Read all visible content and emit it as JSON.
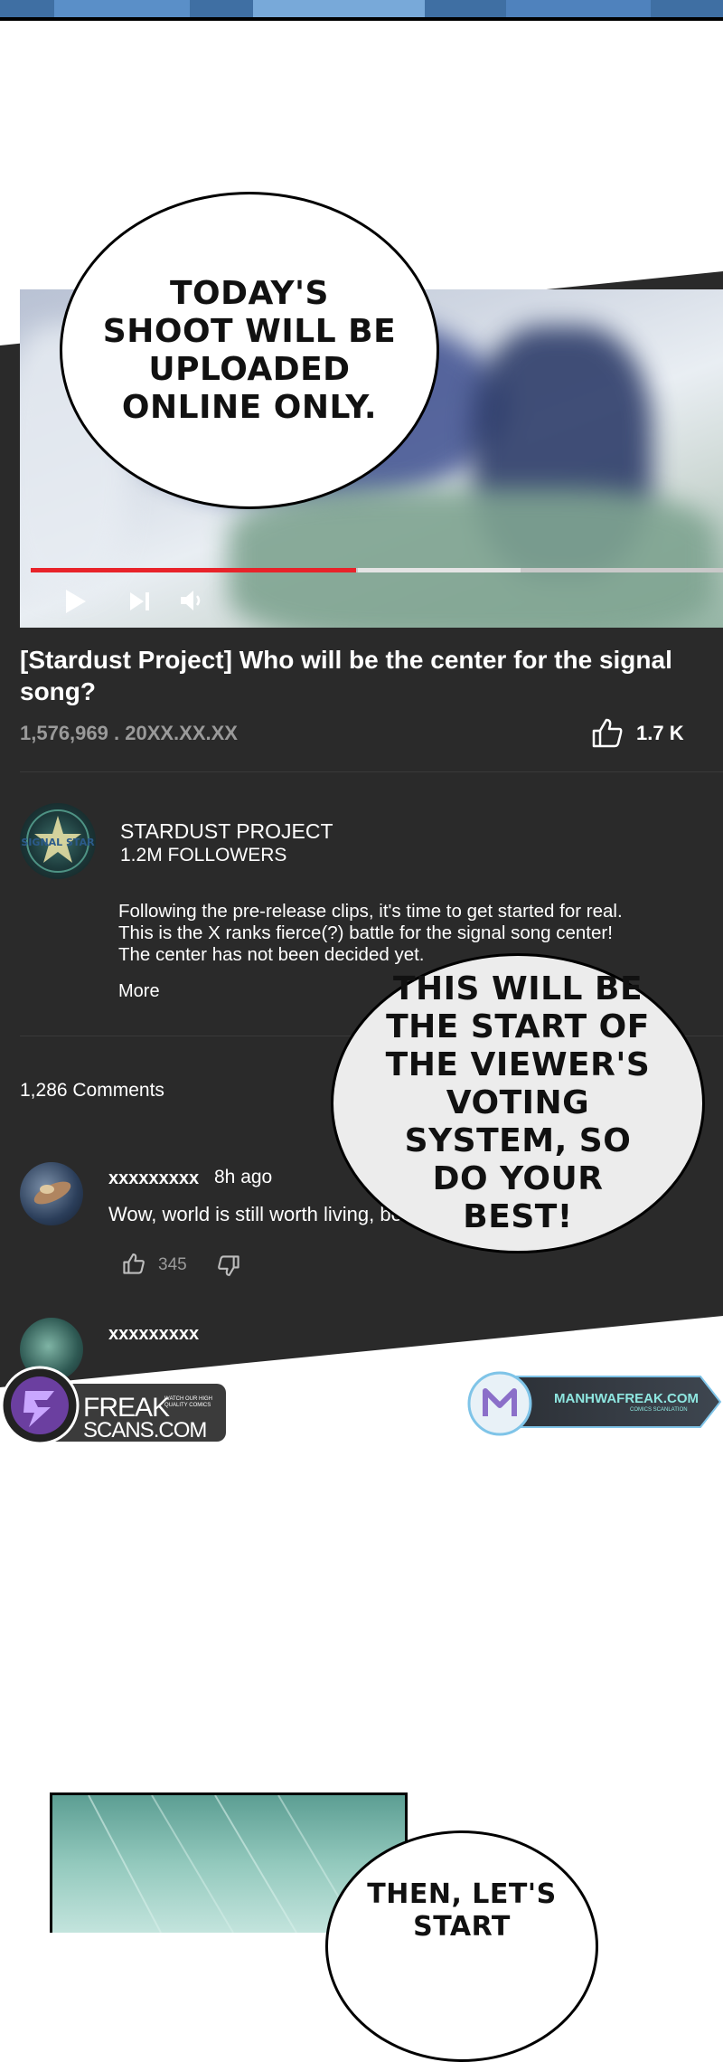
{
  "top_panel": {
    "kind": "comic-panel-edge"
  },
  "bubbles": {
    "shoot_text": "TODAY'S SHOOT WILL BE UPLOADED ONLINE ONLY.",
    "voting_text": "THIS WILL BE THE START OF THE VIEWER'S VOTING SYSTEM, SO DO YOUR BEST!",
    "start_text": "THEN, LET'S START"
  },
  "video": {
    "title": "[Stardust Project] Who will be the center for the signal song?",
    "views": "1,576,969",
    "date": ". 20XX.XX.XX",
    "likes": "1.7 K",
    "progress_fraction": 0.47,
    "controls": [
      "play-icon",
      "skip-next-icon",
      "volume-icon",
      "thumbs-up-icon"
    ]
  },
  "channel": {
    "name": "STARDUST PROJECT",
    "followers": "1.2M FOLLOWERS",
    "logo_text": "SIGNAL STAR",
    "description_lines": [
      "Following the pre-release clips, it's time to get started for real.",
      "This is the X ranks fierce(?) battle for the signal song center!",
      "The center has not been decided yet."
    ],
    "more_label": "More"
  },
  "comments": {
    "count_label": "1,286 Comments",
    "items": [
      {
        "user": "xxxxxxxxx",
        "time": "8h ago",
        "text": "Wow, world is still worth living, beautiful.",
        "likes": "345"
      },
      {
        "user": "xxxxxxxxx"
      }
    ]
  },
  "watermarks": {
    "freak_name": "FREAK",
    "freak_sub": "SCANS.COM",
    "freak_tag": "WATCH OUR HIGH QUALITY COMICS",
    "manhwa_name": "MANHWAFREAK.COM",
    "manhwa_sub": "COMICS SCANLATION"
  },
  "colors": {
    "panel_bg": "#2a2a2a",
    "progress_red": "#e8232a",
    "text_white": "#ffffff",
    "text_gray": "#9a9a9a"
  }
}
